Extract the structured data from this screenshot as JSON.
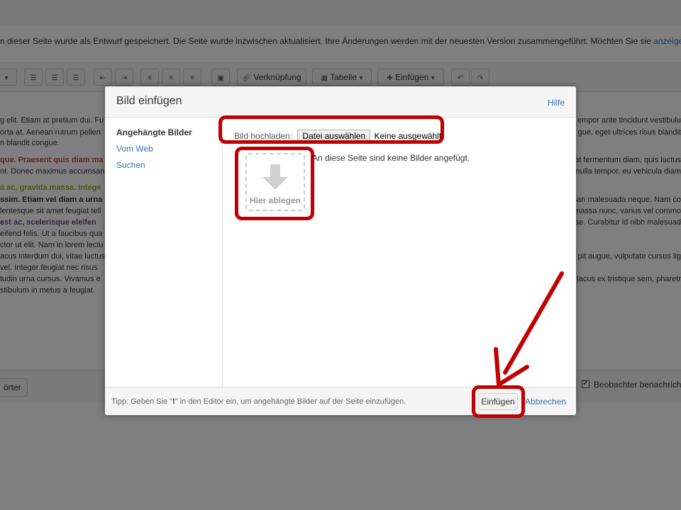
{
  "background": {
    "notice_text": "n dieser Seite wurde als Entwurf gespeichert. Die Seite wurde inzwischen aktualisiert. Ihre Änderungen werden mit der neuesten Version zusammengeführt. Möchten Sie sie ",
    "notice_link": "anzeigen, zusammen",
    "toolbar": {
      "link_label": "Verknüpfung",
      "table_label": "Tabelle",
      "insert_label": "Einfügen"
    },
    "content_left": [
      "g elit. Etiam at pretium dui. Fu",
      "orta at. Aenean rutrum pellen",
      "n blandit congue.",
      "que. Praesent quis diam ma",
      "nt. Donec maximus accumsan",
      "a ac, gravida massa. Intege",
      "ssim. Etiam vel diam a urna c",
      "lentesque sit amet feugiat tell",
      "est ac, scelerisque eleifen",
      "eifend felis. Ut a faucibus qua",
      "ctor ut elit. Nam in lorem lectu",
      "acus interdum dui, vitae luctus",
      " vel. Integer feugiat nec risus",
      "tudin urna cursus. Vivamus e",
      "stibulum in metus a feugiat."
    ],
    "content_right": [
      "empor ante tincidunt vestibulu",
      "gue, eget ultrices risus blandit",
      "at fermentum diam, quis luctus",
      " nulla tempor, eu vehicula diam",
      "san malesuada neque. Nam co",
      "massa nunc, varius vel commo",
      "ae. Curabitur id nibh malesuad",
      "pit augue, vulputate cursus lig",
      "lacus ex tristique sem, pharetr"
    ],
    "bottom_left_button": "örter",
    "watch_label": "Beobachter benachrichtig"
  },
  "dialog": {
    "title": "Bild einfügen",
    "help": "Hilfe",
    "nav": [
      "Angehängte Bilder",
      "Vom Web",
      "Suchen"
    ],
    "upload_label": "Bild hochladen:",
    "file_button": "Datei auswählen",
    "file_status": "Keine ausgewählt",
    "drop_label": "Hier ablegen",
    "no_images": "An diese Seite sind keine Bilder angefügt.",
    "tip_prefix": "Tipp: Geben Sie \"",
    "tip_key": "!",
    "tip_suffix": "\" in den Editor ein, um angehängte Bilder auf der Seite einzufügen.",
    "insert_button": "Einfügen",
    "cancel": "Abbrechen"
  },
  "colors": {
    "highlight": "#c00000",
    "link": "#3572b0"
  }
}
